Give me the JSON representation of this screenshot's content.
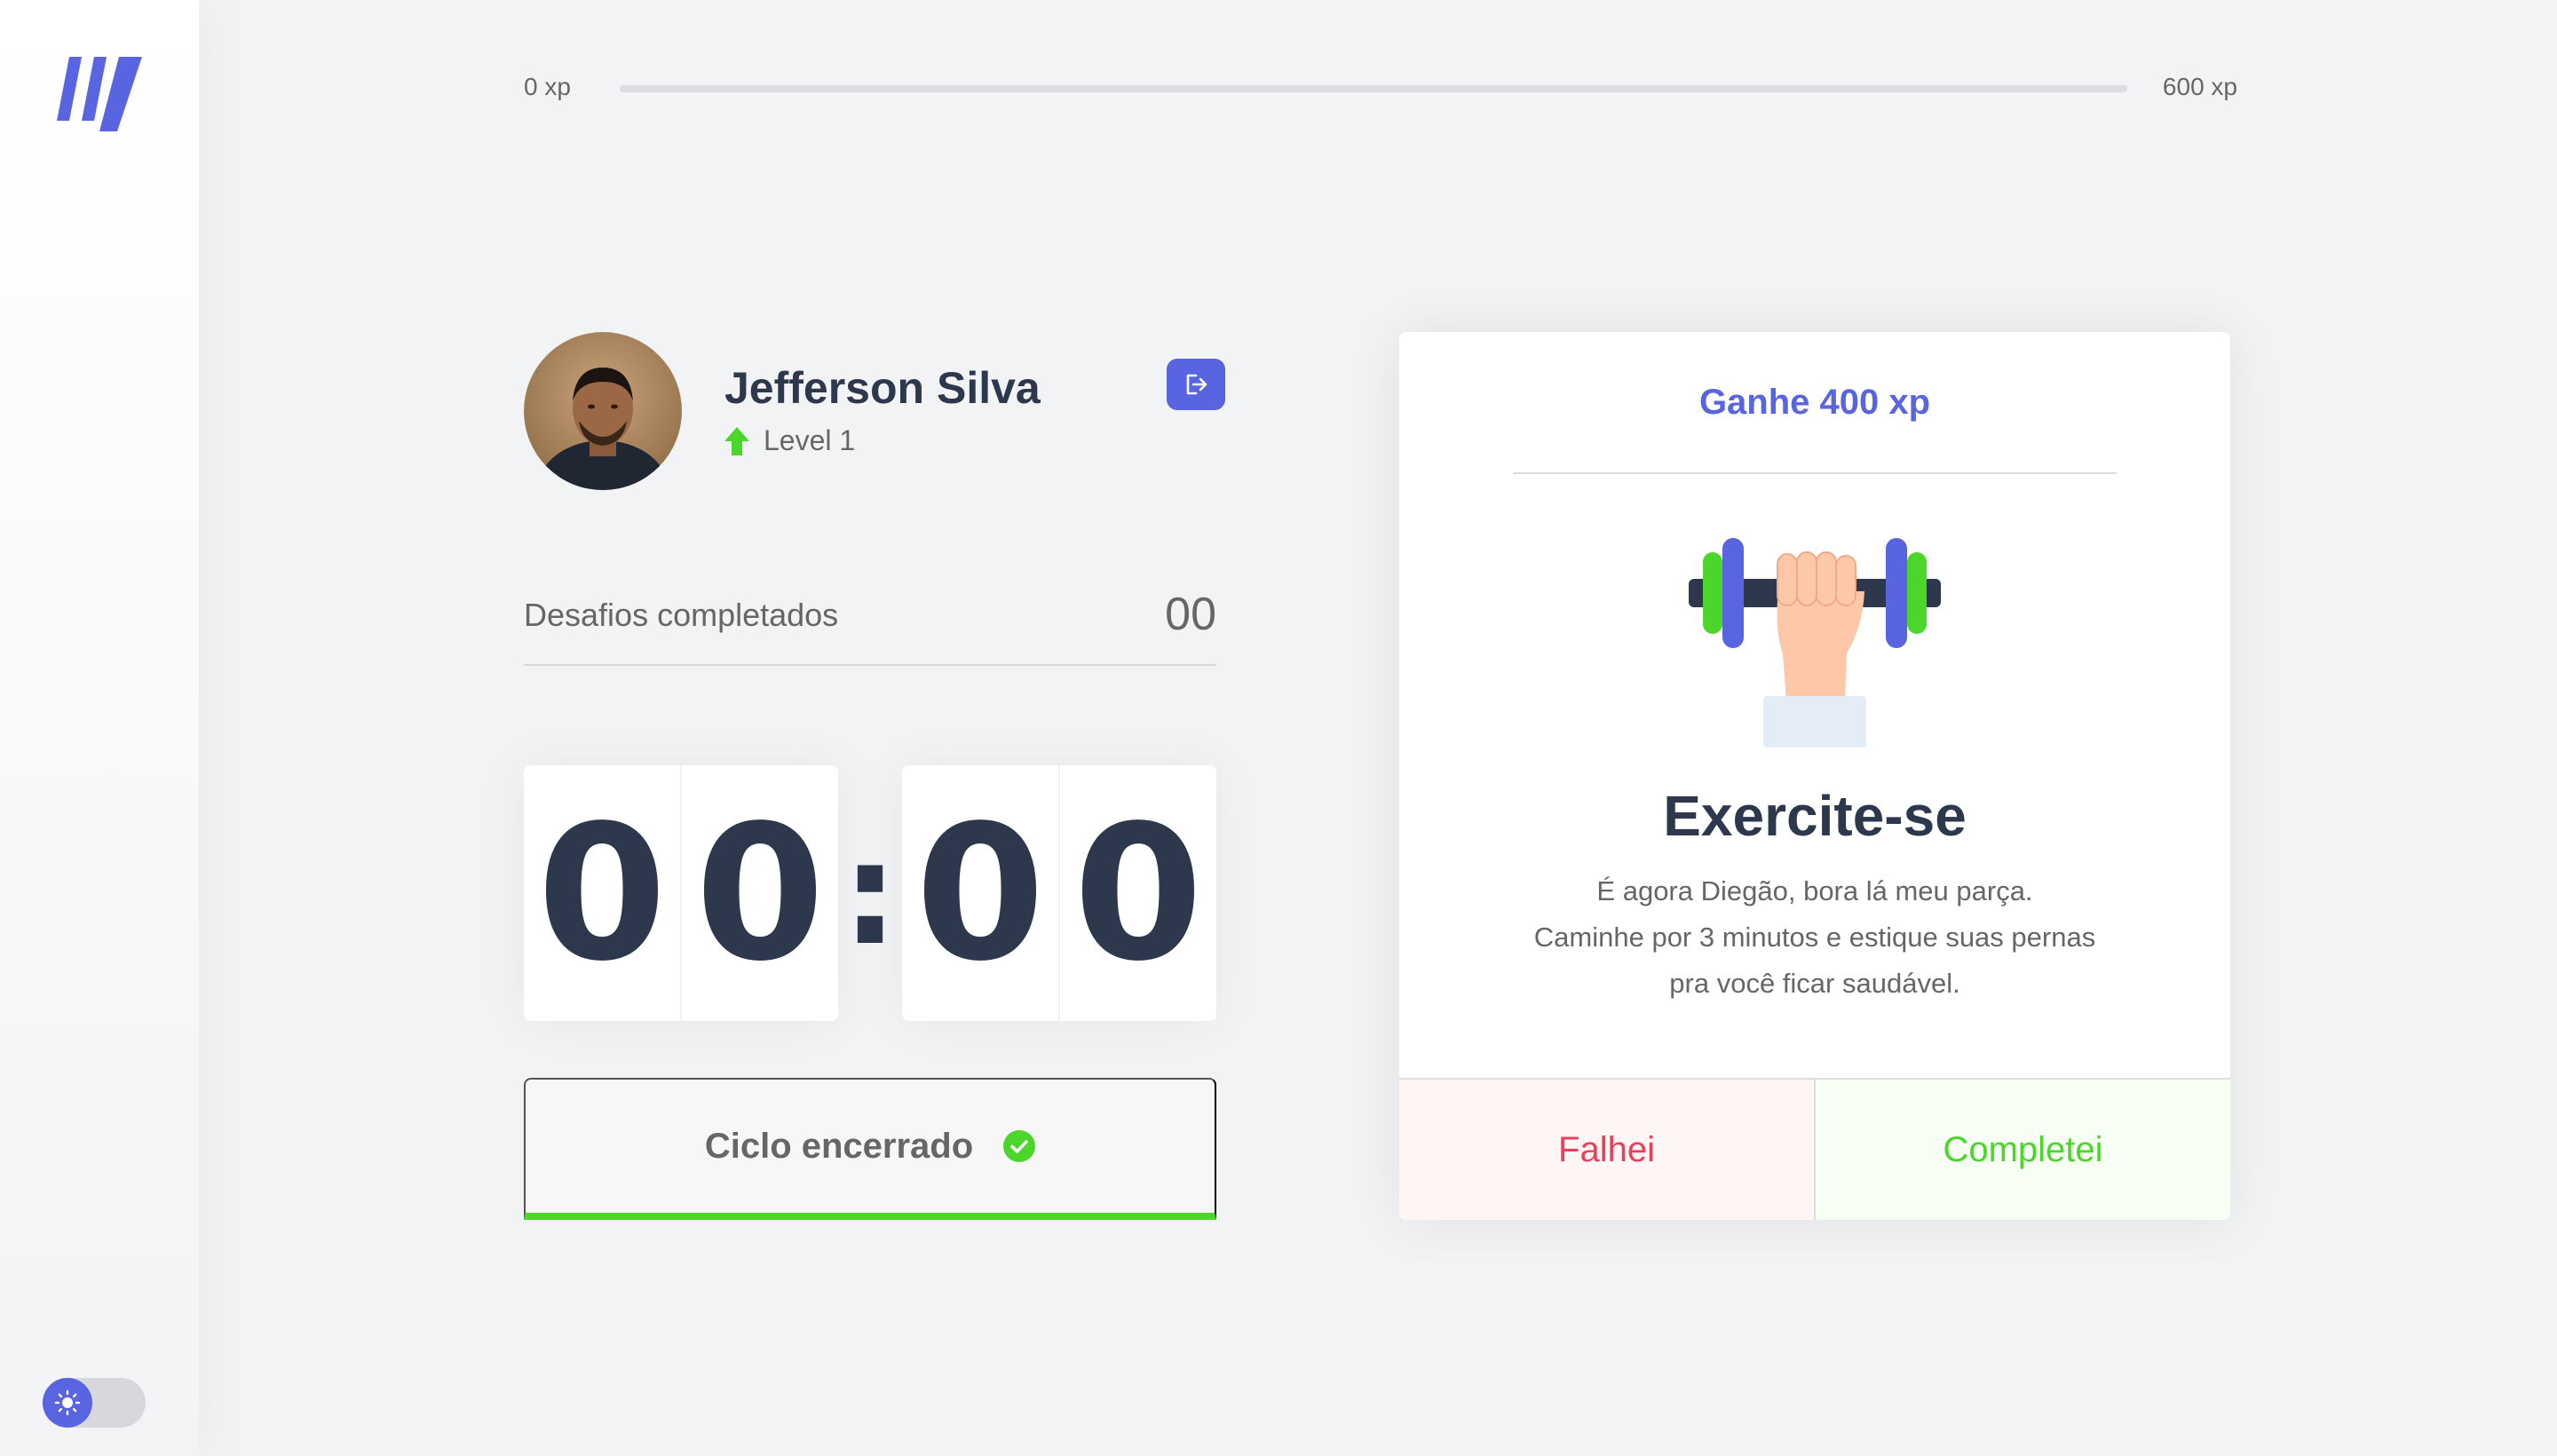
{
  "colors": {
    "accent": "#5965e0",
    "success": "#4cd62b",
    "danger": "#e83f5b",
    "title": "#2e384d",
    "text": "#666666",
    "background": "#f2f3f5"
  },
  "sidebar": {
    "logo_icon": "app-logo-icon",
    "theme_toggle": {
      "icon": "sun-icon",
      "state": "light"
    }
  },
  "xp": {
    "start_label": "0 xp",
    "end_label": "600 xp",
    "progress_percent": 0
  },
  "profile": {
    "name": "Jefferson Silva",
    "level_label": "Level 1",
    "level_icon": "level-up-arrow-icon",
    "logout_icon": "logout-icon"
  },
  "completed": {
    "label": "Desafios completados",
    "count": "00"
  },
  "countdown": {
    "minute_left": "0",
    "minute_right": "0",
    "separator": ":",
    "second_left": "0",
    "second_right": "0"
  },
  "cycle": {
    "label": "Ciclo encerrado",
    "status_icon": "check-circle-icon"
  },
  "challenge": {
    "xp_label": "Ganhe 400 xp",
    "icon": "dumbbell-icon",
    "title": "Exercite-se",
    "description_lines": [
      "É agora Diegão, bora lá meu parça.",
      "Caminhe por 3 minutos e estique suas pernas",
      "pra você ficar saudável."
    ],
    "fail_label": "Falhei",
    "success_label": "Completei"
  }
}
